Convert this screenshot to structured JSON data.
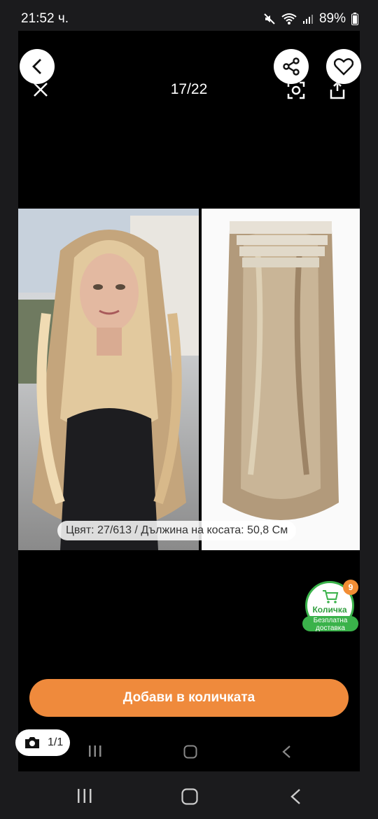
{
  "status_bar": {
    "time": "21:52 ч.",
    "battery": "89%"
  },
  "viewer": {
    "counter": "17/22"
  },
  "photo": {
    "caption": "Цвят: 27/613 / Дължина на косата: 50,8 См"
  },
  "cart": {
    "count": "9",
    "label": "Количка",
    "free_line1": "Безплатна",
    "free_line2": "доставка"
  },
  "add_to_cart": {
    "label": "Добави в количката"
  },
  "photo_counter": {
    "label": "1/1"
  },
  "colors": {
    "accent": "#ef8a3c",
    "cart_green": "#3ab24a"
  }
}
